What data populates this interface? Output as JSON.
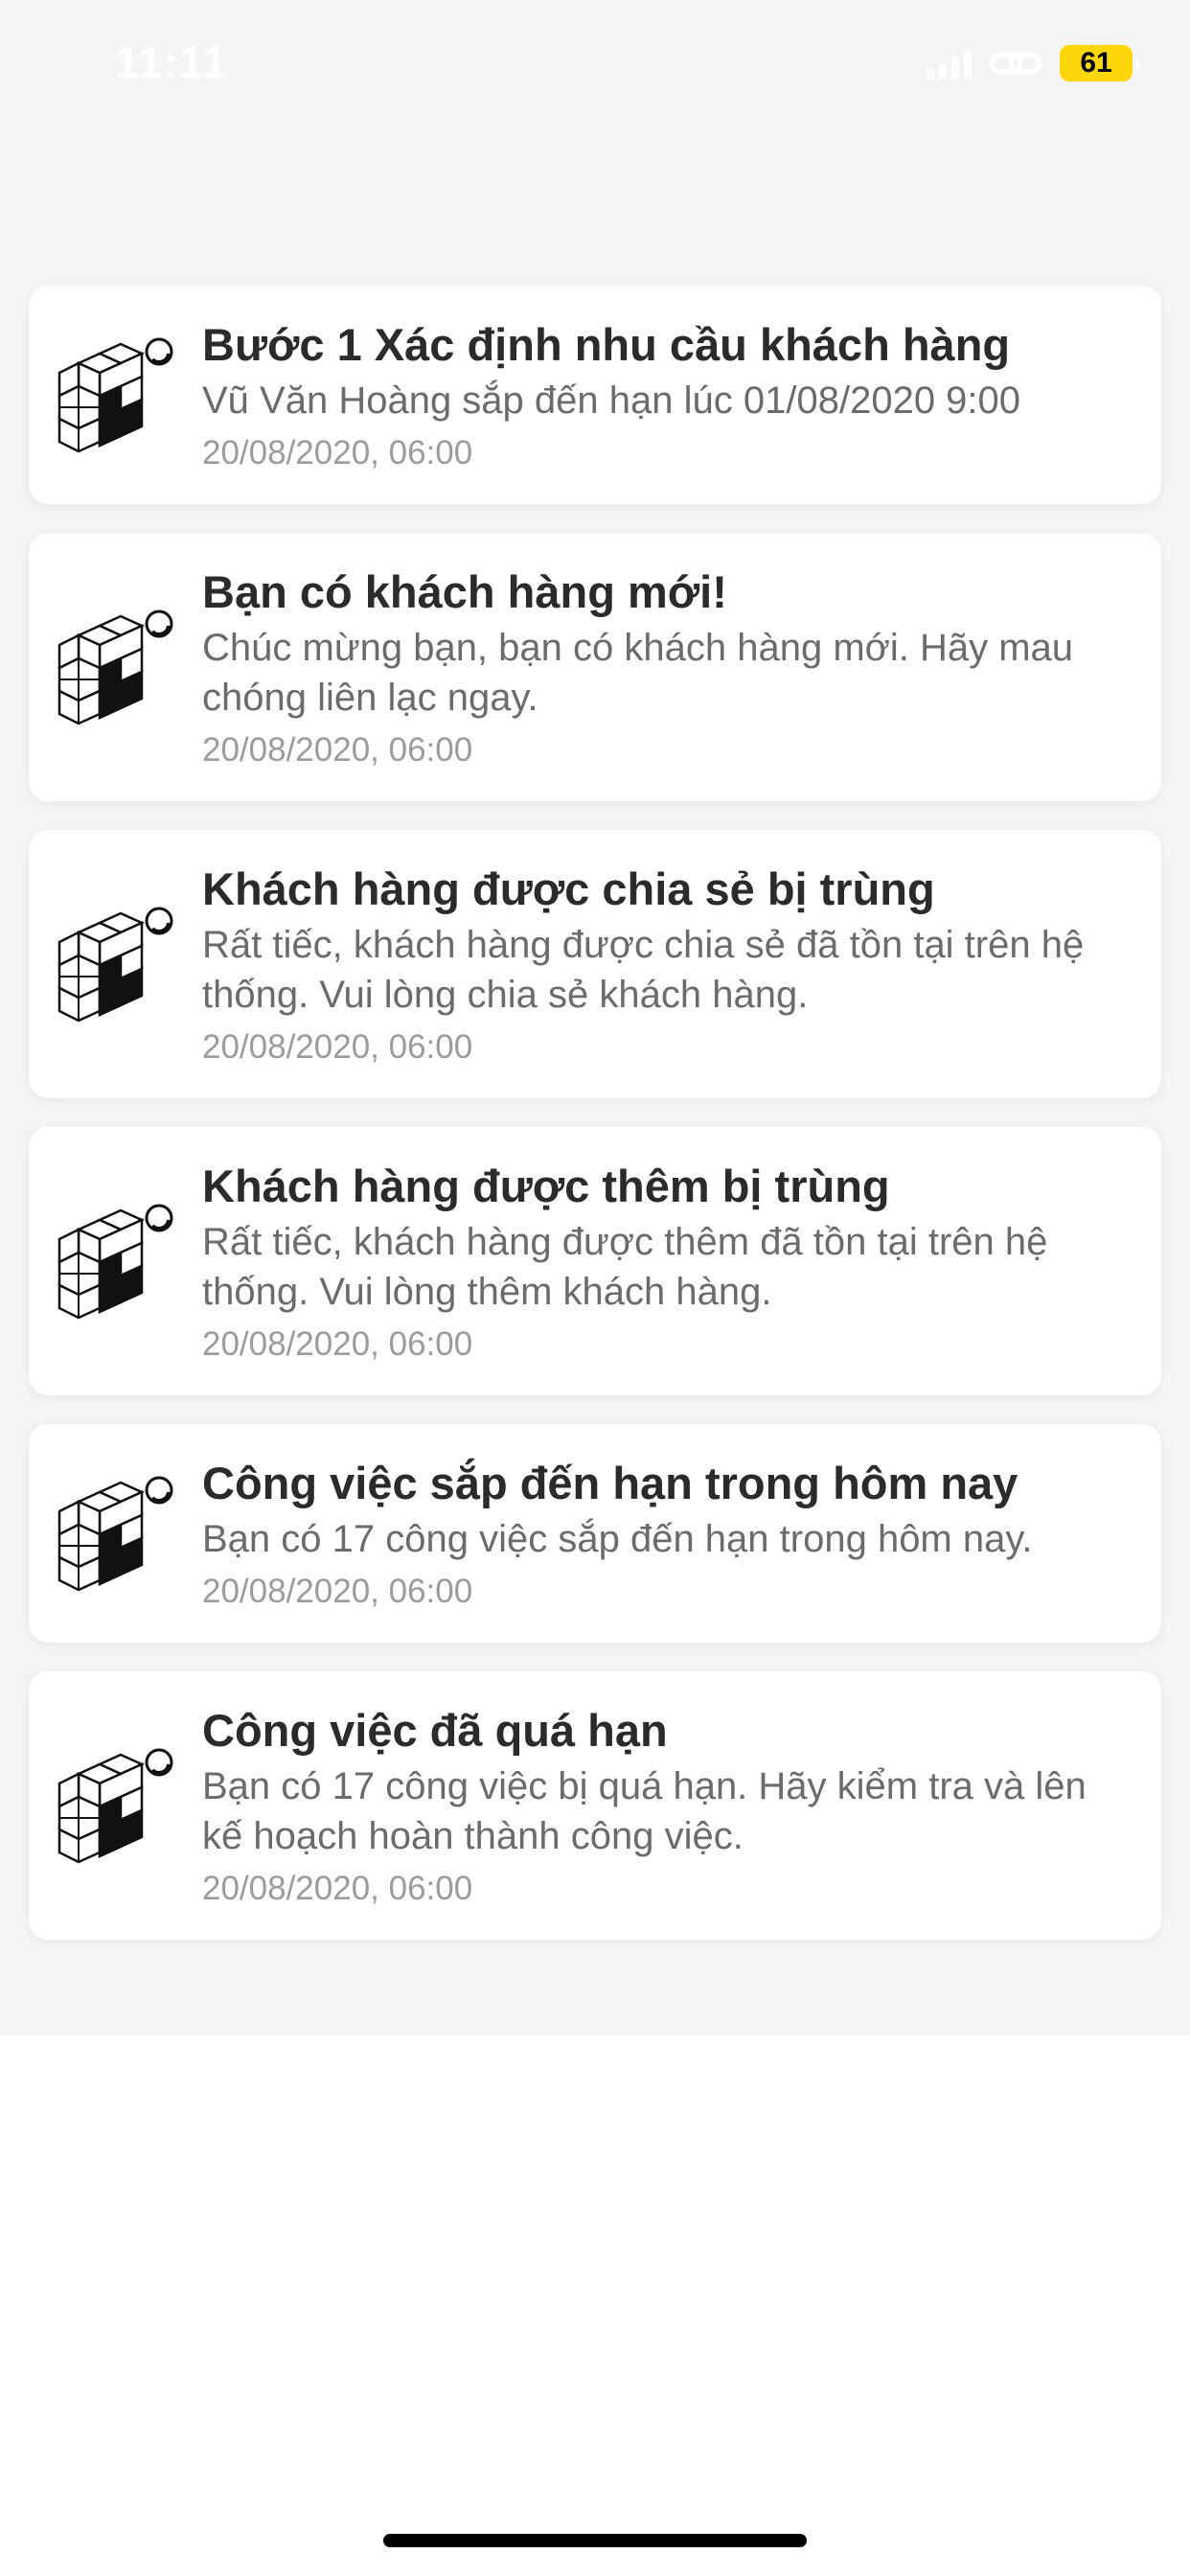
{
  "status_bar": {
    "time": "11:11",
    "battery_level": "61",
    "battery_color": "#ffd60a"
  },
  "notifications": [
    {
      "icon": "cube-blocks-icon",
      "title": "Bước 1 Xác định nhu cầu khách hàng",
      "body": "Vũ Văn Hoàng sắp đến hạn lúc 01/08/2020 9:00",
      "time": "20/08/2020, 06:00"
    },
    {
      "icon": "cube-blocks-icon",
      "title": "Bạn có khách hàng mới!",
      "body": "Chúc mừng bạn, bạn có khách hàng mới. Hãy mau chóng liên lạc ngay.",
      "time": "20/08/2020, 06:00"
    },
    {
      "icon": "cube-blocks-icon",
      "title": "Khách hàng được chia sẻ bị trùng",
      "body": "Rất tiếc, khách hàng được chia sẻ đã tồn tại trên hệ thống. Vui lòng chia sẻ khách hàng.",
      "time": "20/08/2020, 06:00"
    },
    {
      "icon": "cube-blocks-icon",
      "title": "Khách hàng được thêm bị trùng",
      "body": "Rất tiếc, khách hàng được thêm đã tồn tại trên hệ thống. Vui lòng thêm khách hàng.",
      "time": "20/08/2020, 06:00"
    },
    {
      "icon": "cube-blocks-icon",
      "title": "Công việc sắp đến hạn trong hôm nay",
      "body": "Bạn có 17 công việc sắp đến hạn trong hôm nay.",
      "time": "20/08/2020, 06:00"
    },
    {
      "icon": "cube-blocks-icon",
      "title": "Công việc đã quá hạn",
      "body": "Bạn có 17 công việc bị quá hạn. Hãy kiểm tra và lên kế hoạch hoàn thành công việc.",
      "time": "20/08/2020, 06:00"
    }
  ]
}
